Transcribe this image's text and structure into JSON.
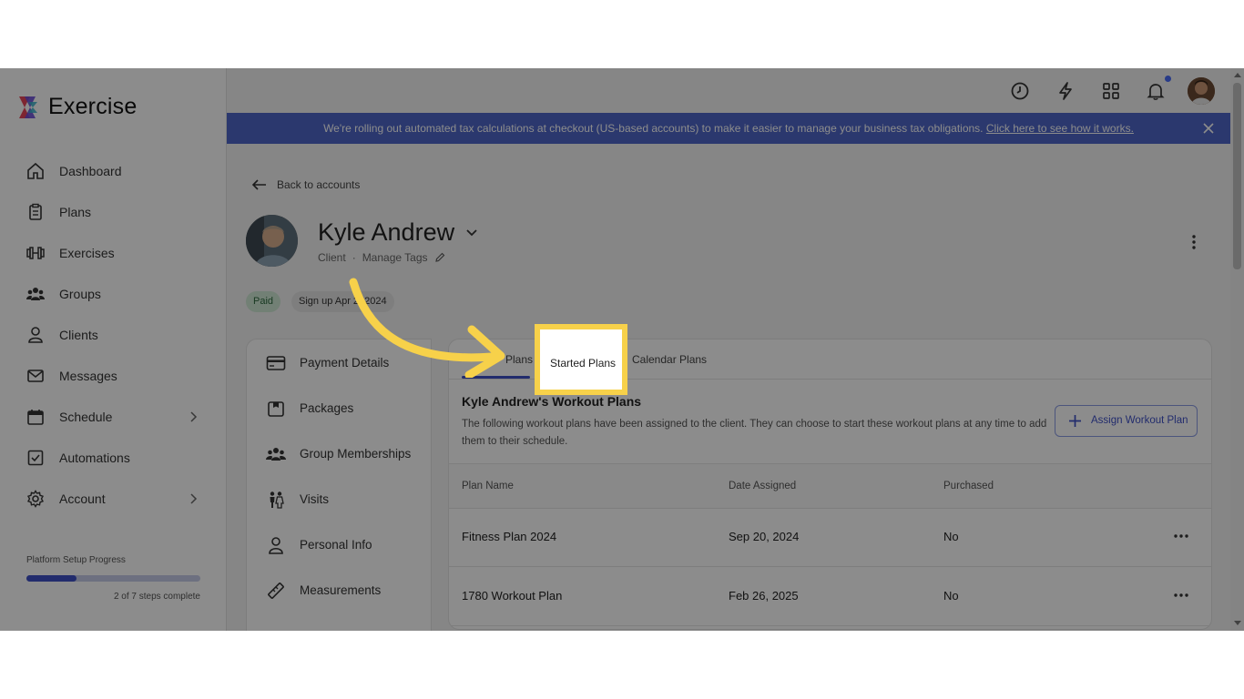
{
  "app": {
    "name": "Exercise"
  },
  "sidebar": {
    "items": [
      {
        "label": "Dashboard",
        "icon": "home-icon"
      },
      {
        "label": "Plans",
        "icon": "clipboard-icon"
      },
      {
        "label": "Exercises",
        "icon": "dumbbell-icon"
      },
      {
        "label": "Groups",
        "icon": "groups-icon"
      },
      {
        "label": "Clients",
        "icon": "user-icon"
      },
      {
        "label": "Messages",
        "icon": "mail-icon"
      },
      {
        "label": "Schedule",
        "icon": "calendar-icon"
      },
      {
        "label": "Automations",
        "icon": "checkbox-icon"
      },
      {
        "label": "Account",
        "icon": "gear-icon"
      }
    ],
    "progress": {
      "label": "Platform Setup Progress",
      "steps_text": "2 of 7 steps complete",
      "completed": 2,
      "total": 7
    }
  },
  "banner": {
    "text": "We're rolling out automated tax calculations at checkout (US-based accounts) to make it easier to manage your business tax obligations. ",
    "link": "Click here to see how it works."
  },
  "page": {
    "back_label": "Back to accounts",
    "client_name": "Kyle Andrew",
    "role": "Client",
    "manage_tags": "Manage Tags",
    "badge_paid": "Paid",
    "badge_signup": "Sign up Apr 2, 2024"
  },
  "client_menu": [
    {
      "label": "Payment Details",
      "icon": "credit-card-icon"
    },
    {
      "label": "Packages",
      "icon": "package-icon"
    },
    {
      "label": "Group Memberships",
      "icon": "groups-icon"
    },
    {
      "label": "Visits",
      "icon": "visits-icon"
    },
    {
      "label": "Personal Info",
      "icon": "user-icon"
    },
    {
      "label": "Measurements",
      "icon": "ruler-icon"
    }
  ],
  "tabs": {
    "assigned": "Plans",
    "started": "Started Plans",
    "calendar": "Calendar Plans"
  },
  "workout_plans": {
    "title": "Kyle Andrew's Workout Plans",
    "description": "The following workout plans have been assigned to the client. They can choose to start these workout plans at any time to add them to their schedule.",
    "assign_button": "Assign Workout Plan",
    "columns": [
      "Plan Name",
      "Date Assigned",
      "Purchased"
    ],
    "rows": [
      {
        "name": "Fitness Plan 2024",
        "date": "Sep 20, 2024",
        "purchased": "No"
      },
      {
        "name": "1780 Workout Plan",
        "date": "Feb 26, 2025",
        "purchased": "No"
      }
    ]
  },
  "colors": {
    "accent": "#3f51c7",
    "banner": "#4f66c8",
    "highlight": "#f7d14a",
    "paid_badge": "#cfe9d5"
  }
}
